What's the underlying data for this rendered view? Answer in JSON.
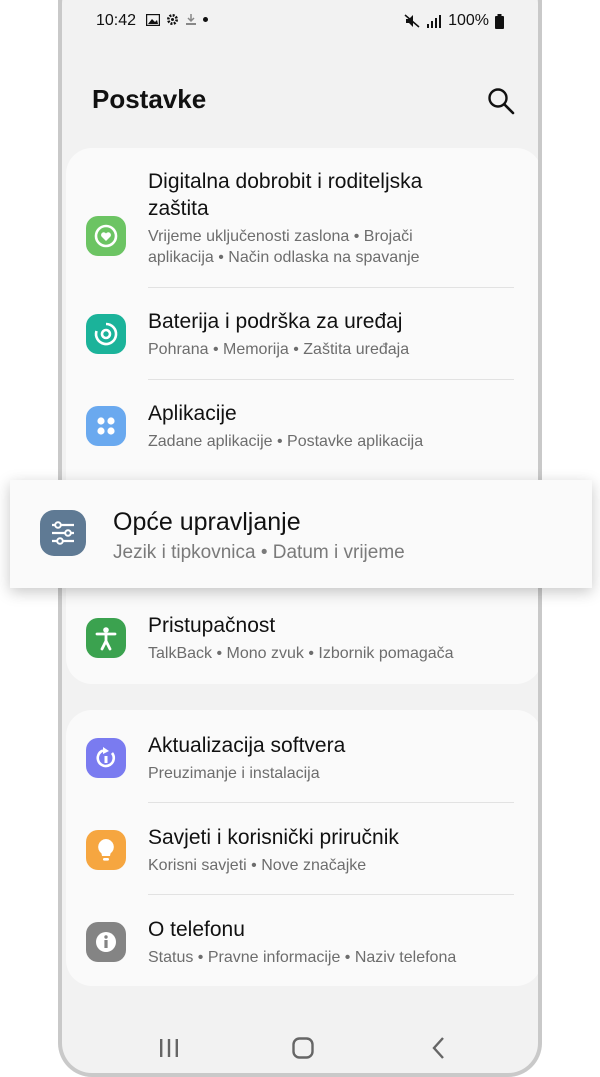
{
  "status_bar": {
    "time": "10:42",
    "battery": "100%"
  },
  "header": {
    "title": "Postavke"
  },
  "items": [
    {
      "title_line1": "Digitalna dobrobit i roditeljska",
      "title_line2": "zaštita",
      "sub_line1": "Vrijeme uključenosti zaslona  •  Brojači",
      "sub_line2": "aplikacija  •  Način odlaska na spavanje",
      "icon": "wellbeing-icon",
      "color": "#6cc463"
    },
    {
      "title": "Baterija i podrška za uređaj",
      "sub": "Pohrana  •  Memorija  •  Zaštita uređaja",
      "icon": "device-care-icon",
      "color": "#1bb39a"
    },
    {
      "title": "Aplikacije",
      "sub": "Zadane aplikacije  •  Postavke aplikacija",
      "icon": "apps-icon",
      "color": "#6aa9ef"
    },
    {
      "title": "Pristupačnost",
      "sub": "TalkBack  •  Mono zvuk  •  Izbornik pomagača",
      "icon": "accessibility-icon",
      "color": "#3ba24f"
    },
    {
      "title": "Aktualizacija softvera",
      "sub": "Preuzimanje i instalacija",
      "icon": "software-update-icon",
      "color": "#7a7bf0"
    },
    {
      "title": "Savjeti i korisnički priručnik",
      "sub": "Korisni savjeti  •  Nove značajke",
      "icon": "tips-icon",
      "color": "#f6a640"
    },
    {
      "title": "O telefonu",
      "sub": "Status  •  Pravne informacije  •  Naziv telefona",
      "icon": "info-icon",
      "color": "#848484"
    }
  ],
  "highlight": {
    "title": "Opće upravljanje",
    "sub": "Jezik i tipkovnica  •  Datum i vrijeme",
    "icon": "general-management-icon",
    "color": "#5f7a94"
  }
}
